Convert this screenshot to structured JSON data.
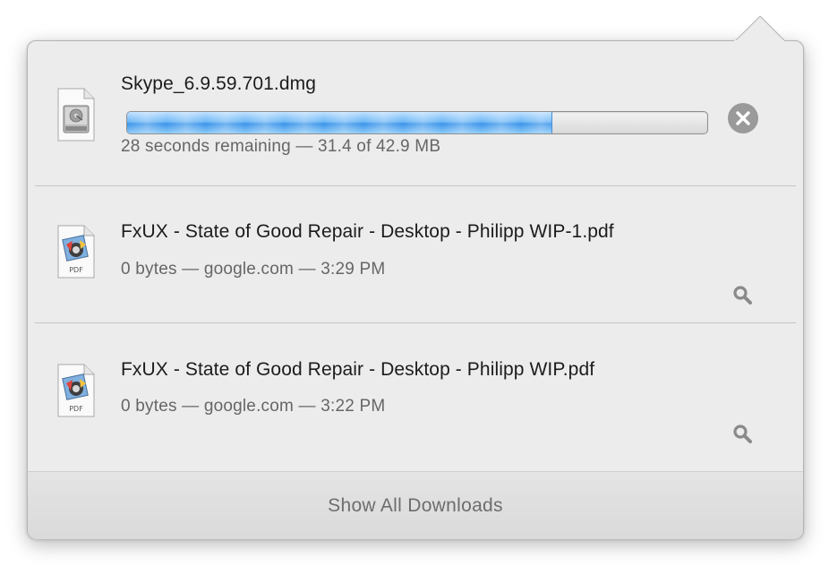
{
  "footer": {
    "label": "Show All Downloads"
  },
  "downloads": [
    {
      "name": "Skype_6.9.59.701.dmg",
      "status": "28 seconds remaining — 31.4 of 42.9 MB",
      "state": "in-progress",
      "progress_fraction": 0.732,
      "icon": "disk-image-icon",
      "action_icon": "cancel-icon"
    },
    {
      "name": "FxUX - State of Good Repair - Desktop - Philipp WIP-1.pdf",
      "status": "0 bytes — google.com — 3:29 PM",
      "state": "complete",
      "icon": "pdf-document-icon",
      "icon_label": "PDF",
      "action_icon": "magnifier-icon"
    },
    {
      "name": "FxUX - State of Good Repair - Desktop - Philipp WIP.pdf",
      "status": "0 bytes — google.com — 3:22 PM",
      "state": "complete",
      "icon": "pdf-document-icon",
      "icon_label": "PDF",
      "action_icon": "magnifier-icon"
    }
  ],
  "colors": {
    "panel_background": "#ececec",
    "progress_blue": "#3b94ea",
    "cancel_button": "#9a9a9a",
    "secondary_text": "#666666"
  }
}
